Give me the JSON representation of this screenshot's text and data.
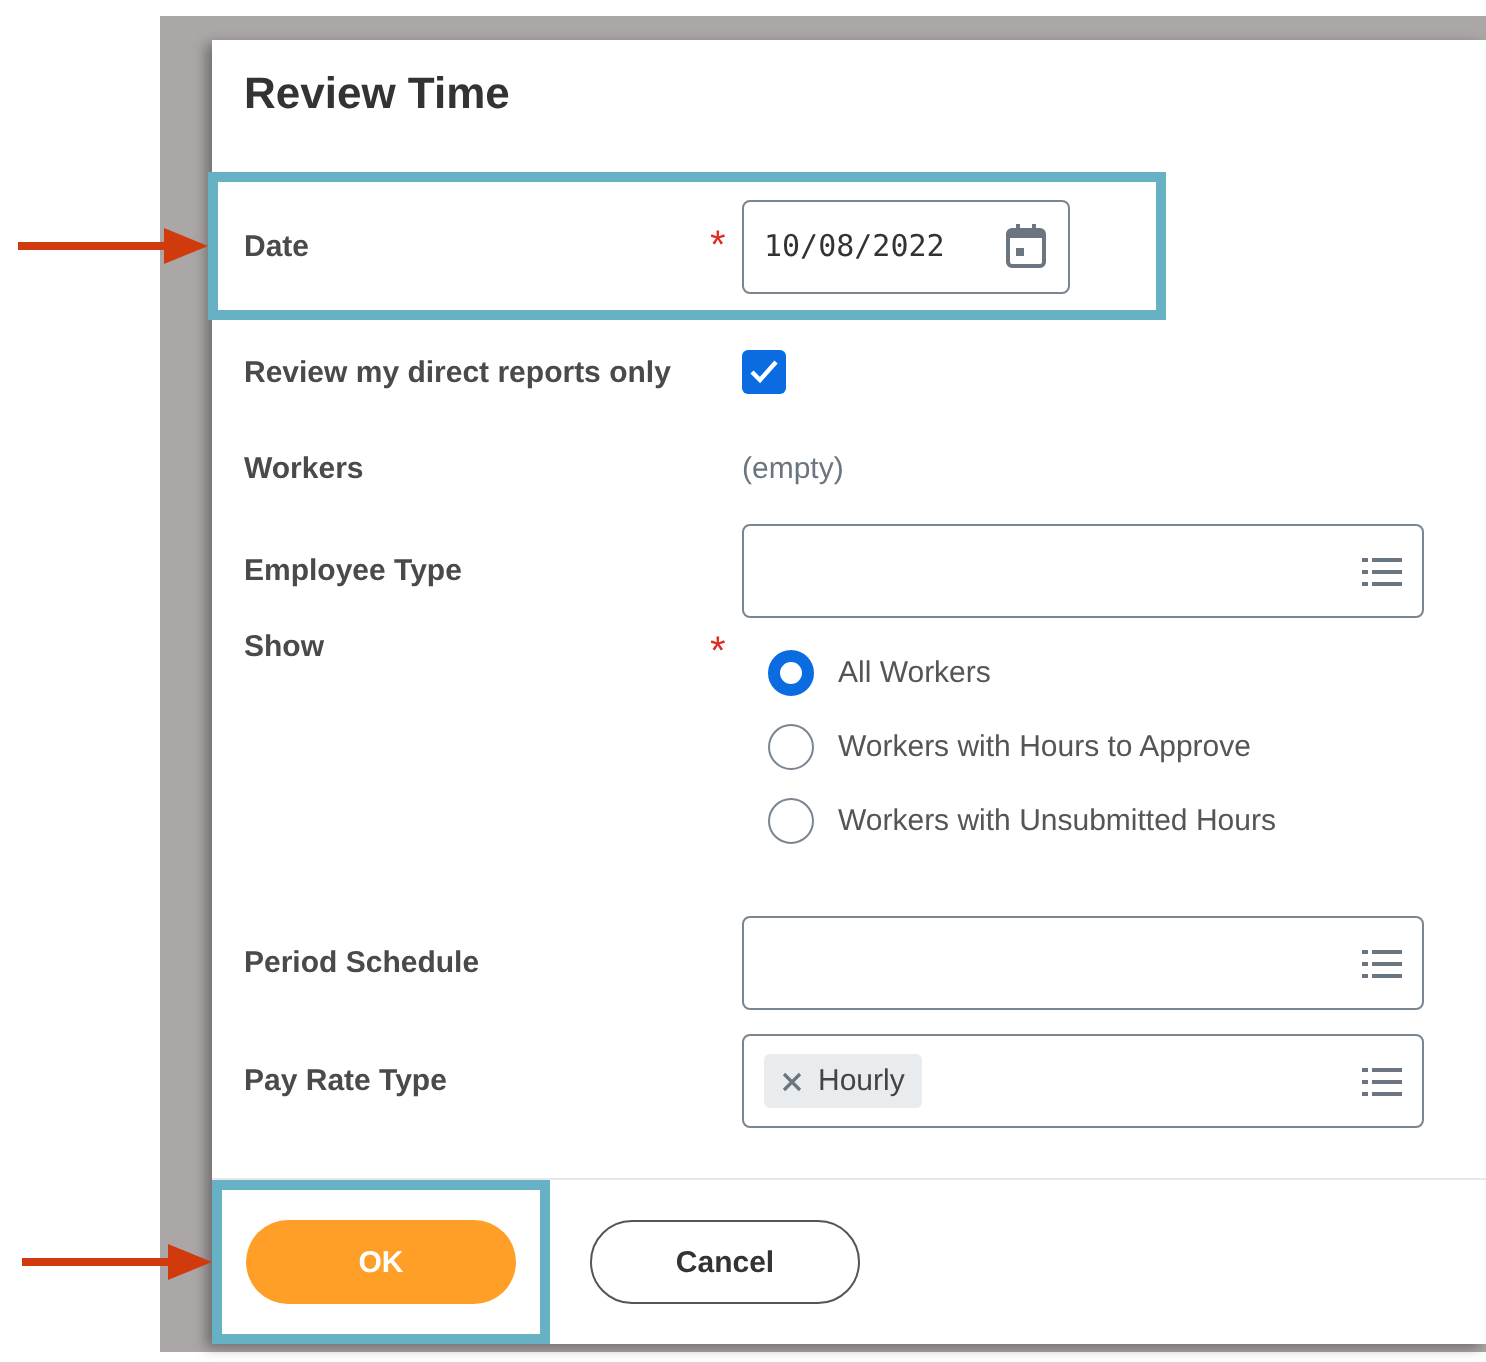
{
  "dialog": {
    "title": "Review Time"
  },
  "fields": [
    {
      "kind": "date",
      "label": "Date",
      "required_mark": "*",
      "value": "10/08/2022",
      "highlighted": true
    },
    {
      "kind": "checkbox",
      "label": "Review my direct reports only",
      "checked": true
    },
    {
      "kind": "readonly",
      "label": "Workers",
      "value": "(empty)"
    },
    {
      "kind": "prompt",
      "label": "Employee Type"
    },
    {
      "kind": "radio",
      "label": "Show",
      "required_mark": "*",
      "options": [
        {
          "label": "All Workers",
          "selected": true
        },
        {
          "label": "Workers with Hours to Approve",
          "selected": false
        },
        {
          "label": "Workers with Unsubmitted Hours",
          "selected": false
        }
      ]
    },
    {
      "kind": "prompt",
      "label": "Period Schedule"
    },
    {
      "kind": "prompt",
      "label": "Pay Rate Type",
      "chips": [
        "Hourly"
      ]
    }
  ],
  "buttons": [
    {
      "label": "OK",
      "kind": "primary",
      "highlighted": true
    },
    {
      "label": "Cancel",
      "kind": "secondary",
      "highlighted": false
    }
  ]
}
